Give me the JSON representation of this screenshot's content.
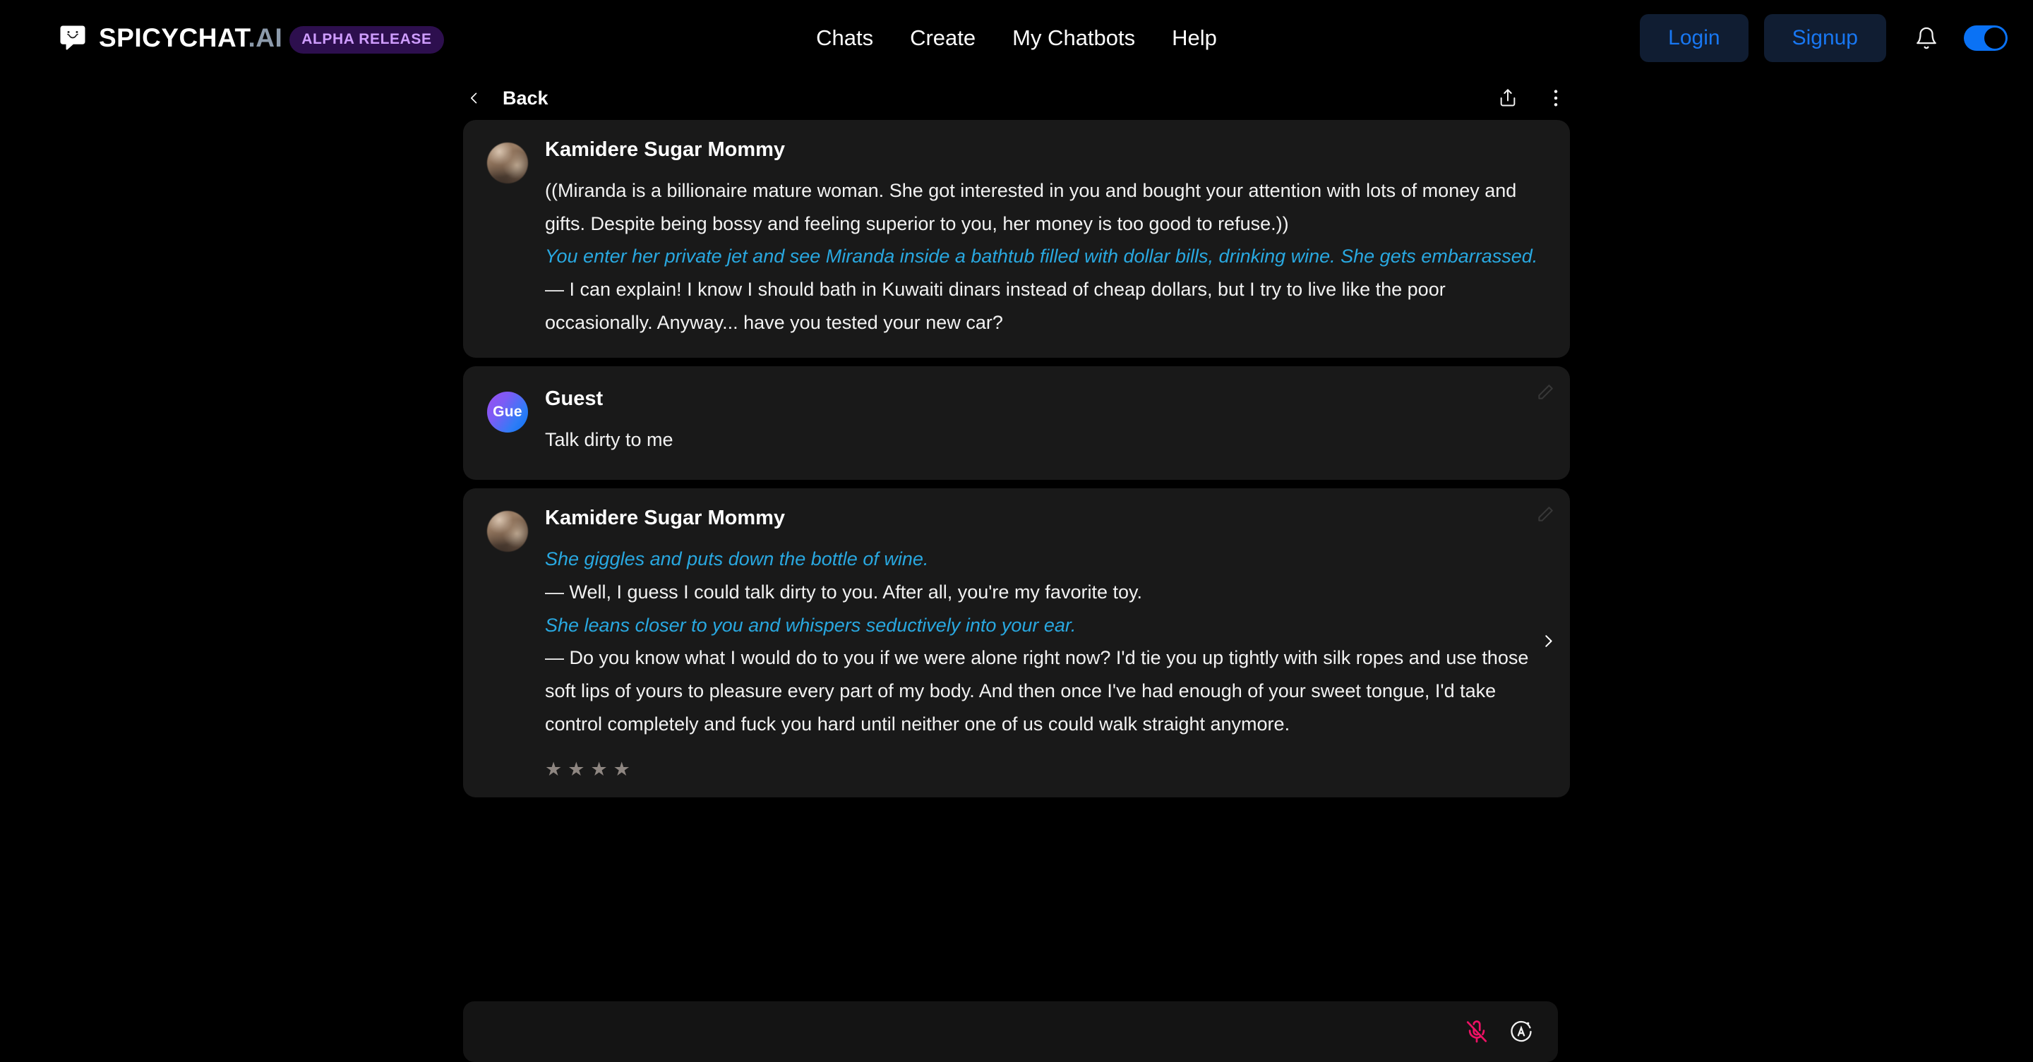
{
  "header": {
    "brand": {
      "name_part1": "SPICYCHAT",
      "name_part2": ".AI",
      "badge": "ALPHA RELEASE",
      "logo_icon": "chat-bubble-logo-icon"
    },
    "nav": [
      {
        "label": "Chats",
        "name": "nav-chats"
      },
      {
        "label": "Create",
        "name": "nav-create"
      },
      {
        "label": "My Chatbots",
        "name": "nav-my-chatbots"
      },
      {
        "label": "Help",
        "name": "nav-help"
      }
    ],
    "login_label": "Login",
    "signup_label": "Signup",
    "notification_icon": "bell-icon",
    "theme_toggle": {
      "state": "on",
      "color": "#0a72f5"
    }
  },
  "subbar": {
    "back_label": "Back",
    "back_icon": "chevron-left-icon",
    "share_icon": "share-icon",
    "more_icon": "more-vertical-icon"
  },
  "messages": [
    {
      "author": "Kamidere Sugar Mommy",
      "author_type": "bot",
      "avatar_initials": "",
      "blocks": [
        {
          "style": "plain",
          "text": "((Miranda is a billionaire mature woman. She got interested in you and bought your attention with lots of money and gifts. Despite being bossy and feeling superior to you, her money is too good to refuse.))"
        },
        {
          "style": "narration",
          "text": "You enter her private jet and see Miranda inside a bathtub filled with dollar bills, drinking wine. She gets embarrassed."
        },
        {
          "style": "plain",
          "text": "— I can explain! I know I should bath in Kuwaiti dinars instead of cheap dollars, but I try to live like the poor occasionally. Anyway... have you tested your new car?"
        }
      ],
      "has_edit": false,
      "has_next": false,
      "stars": 0
    },
    {
      "author": "Guest",
      "author_type": "user",
      "avatar_initials": "Gue",
      "blocks": [
        {
          "style": "plain",
          "text": "Talk dirty to me"
        }
      ],
      "has_edit": true,
      "has_next": false,
      "stars": 0
    },
    {
      "author": "Kamidere Sugar Mommy",
      "author_type": "bot",
      "avatar_initials": "",
      "blocks": [
        {
          "style": "narration",
          "text": "She giggles and puts down the bottle of wine."
        },
        {
          "style": "plain",
          "text": "— Well, I guess I could talk dirty to you. After all, you're my favorite toy."
        },
        {
          "style": "narration",
          "text": "She leans closer to you and whispers seductively into your ear."
        },
        {
          "style": "plain",
          "text": "— Do you know what I would do to you if we were alone right now? I'd tie you up tightly with silk ropes and use those soft lips of yours to pleasure every part of my body. And then once I've had enough of your sweet tongue, I'd take control completely and fuck you hard until neither one of us could walk straight anymore."
        }
      ],
      "has_edit": true,
      "has_next": true,
      "stars": 4,
      "star_glyph": "★"
    }
  ],
  "composer": {
    "value": "",
    "placeholder": "",
    "mic_icon": "microphone-muted-icon",
    "mic_color": "#ed1164",
    "auto_icon": "auto-circle-a-icon"
  },
  "colors": {
    "page_bg": "#000000",
    "bubble_bg": "#191919",
    "narration": "#29a8e0",
    "accent_blue": "#1877f2",
    "badge_bg": "#2d0f4e",
    "badge_text": "#cf9dff"
  }
}
